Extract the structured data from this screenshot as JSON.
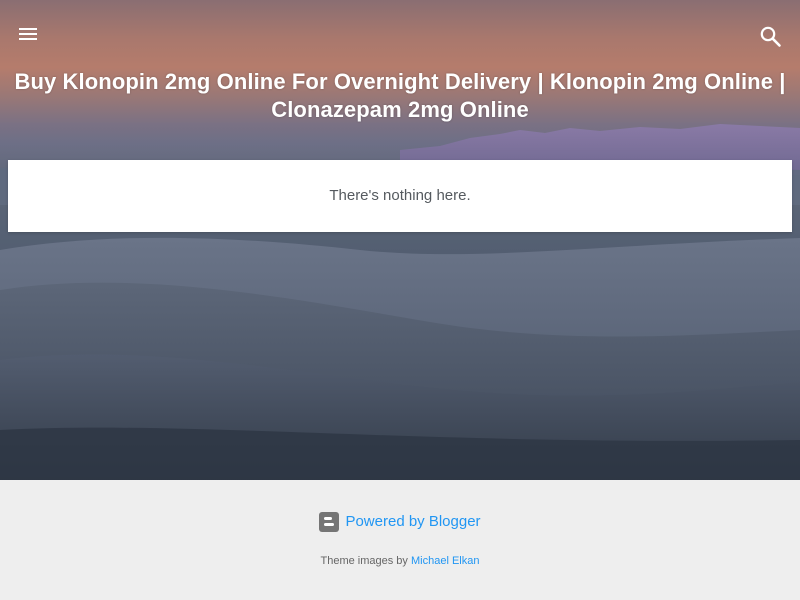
{
  "header": {
    "title": "Buy Klonopin 2mg Online For Overnight Delivery | Klonopin 2mg Online | Clonazepam 2mg Online",
    "menu_icon": "hamburger-menu-icon",
    "search_icon": "search-icon"
  },
  "main": {
    "empty_message": "There's nothing here."
  },
  "footer": {
    "powered_by": "Powered by Blogger",
    "theme_images_prefix": "Theme images by",
    "theme_images_author": "Michael Elkan",
    "blogger_icon": "blogger-logo-icon"
  },
  "colors": {
    "link": "#2196f3",
    "footer_bg": "#eeeeee",
    "card_bg": "#ffffff",
    "title_text": "#ffffff"
  }
}
